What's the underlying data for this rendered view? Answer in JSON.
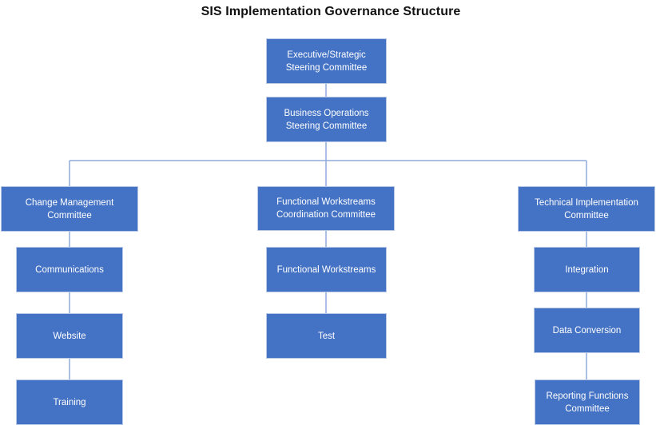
{
  "diagram": {
    "title": "SIS Implementation Governance Structure",
    "colors": {
      "node_fill": "#4472c4",
      "node_text": "#ffffff",
      "connector": "#8faadc",
      "title_text": "#111111"
    },
    "nodes": {
      "executive": "Executive/Strategic\nSteering Committee",
      "business_ops": "Business Operations\nSteering Committee",
      "change_mgmt": "Change Management\nCommittee",
      "functional_coord": "Functional Workstreams\nCoordination Committee",
      "technical_impl": "Technical Implementation\nCommittee",
      "communications": "Communications",
      "website": "Website",
      "training": "Training",
      "functional_workstreams": "Functional Workstreams",
      "test": "Test",
      "integration": "Integration",
      "data_conversion": "Data Conversion",
      "reporting_functions": "Reporting Functions\nCommittee"
    },
    "edges": [
      [
        "executive",
        "business_ops"
      ],
      [
        "business_ops",
        "change_mgmt"
      ],
      [
        "business_ops",
        "functional_coord"
      ],
      [
        "business_ops",
        "technical_impl"
      ],
      [
        "change_mgmt",
        "communications"
      ],
      [
        "communications",
        "website"
      ],
      [
        "website",
        "training"
      ],
      [
        "functional_coord",
        "functional_workstreams"
      ],
      [
        "functional_workstreams",
        "test"
      ],
      [
        "technical_impl",
        "integration"
      ],
      [
        "integration",
        "data_conversion"
      ],
      [
        "data_conversion",
        "reporting_functions"
      ]
    ]
  }
}
